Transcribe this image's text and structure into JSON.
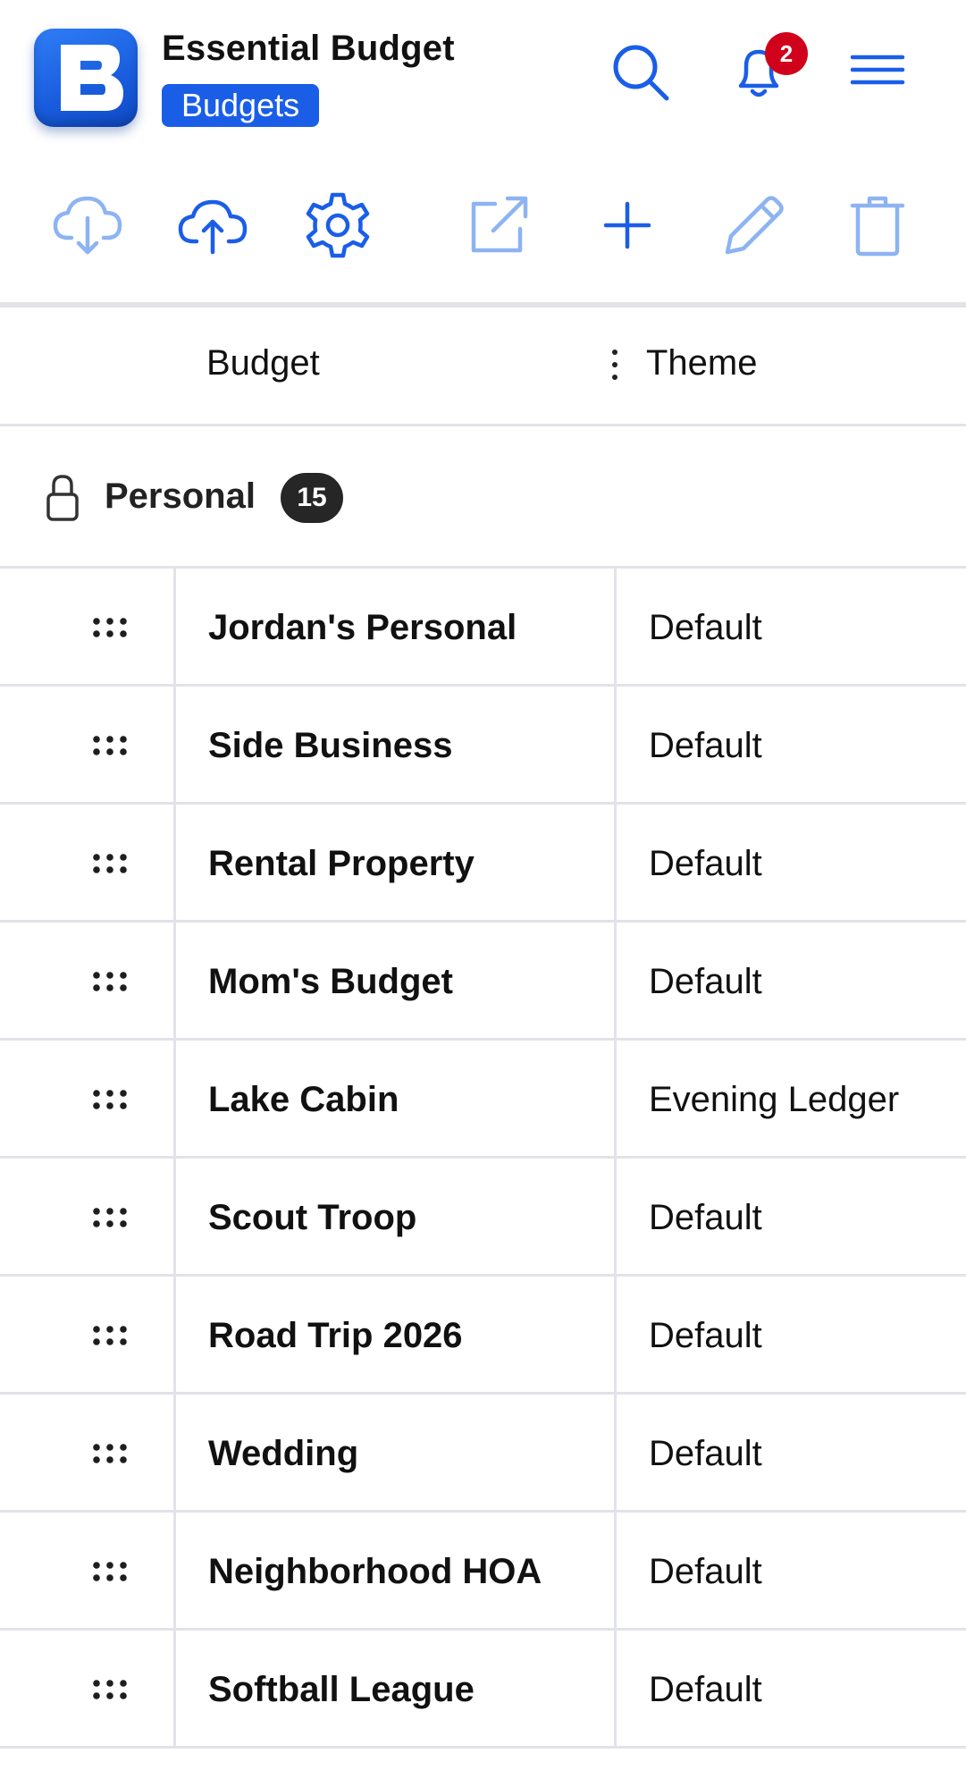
{
  "app": {
    "title": "Essential Budget",
    "section": "Budgets",
    "logo_letter": "B",
    "notification_count": "2",
    "accent_color": "#1a5ee8",
    "badge_color": "#d0021b"
  },
  "header": {
    "icons": [
      "search-icon",
      "bell-icon",
      "menu-icon"
    ]
  },
  "toolbar": {
    "icons": [
      "cloud-download-icon",
      "cloud-upload-icon",
      "gear-icon",
      "open-external-icon",
      "plus-icon",
      "pencil-icon",
      "trash-icon"
    ]
  },
  "table": {
    "columns": [
      "Budget",
      "Theme"
    ]
  },
  "group": {
    "name": "Personal",
    "count": "15"
  },
  "rows": [
    {
      "name": "Jordan's Personal",
      "theme": "Default"
    },
    {
      "name": "Side Business",
      "theme": "Default"
    },
    {
      "name": "Rental Property",
      "theme": "Default"
    },
    {
      "name": "Mom's Budget",
      "theme": "Default"
    },
    {
      "name": "Lake Cabin",
      "theme": "Evening Ledger"
    },
    {
      "name": "Scout Troop",
      "theme": "Default"
    },
    {
      "name": "Road Trip 2026",
      "theme": "Default"
    },
    {
      "name": "Wedding",
      "theme": "Default"
    },
    {
      "name": "Neighborhood HOA",
      "theme": "Default"
    },
    {
      "name": "Softball League",
      "theme": "Default"
    }
  ]
}
